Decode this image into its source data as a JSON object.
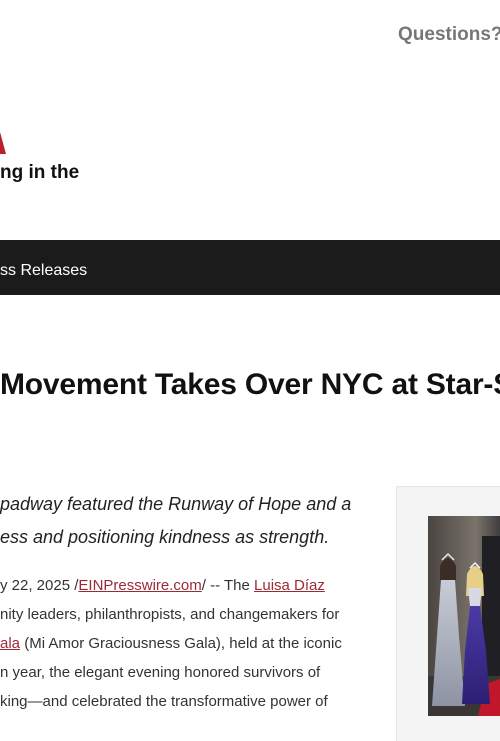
{
  "header": {
    "questions_label": "Questions?",
    "tagline": "ng in the"
  },
  "nav": {
    "item_label": "ss Releases"
  },
  "article": {
    "headline": "Movement Takes Over NYC at Star-S",
    "lede_lines": [
      "padway featured the Runway of Hope and a",
      "ess and positioning kindness as strength."
    ],
    "dateline_prefix": "y 22, 2025 /",
    "source_link": "EINPresswire.com",
    "dateline_middle": "/ -- The ",
    "person_link": "Luisa Díaz",
    "body_line_2": "nity leaders, philanthropists, and changemakers for",
    "gala_link": "ala",
    "body_line_3_rest": " (Mi Amor Graciousness Gala), held at the iconic",
    "body_line_4": "n year, the elegant evening honored survivors of",
    "body_line_5": "king—and celebrated the transformative power of"
  },
  "colors": {
    "navbar": "#1b1b1b",
    "link": "#9b2a35",
    "brand_red": "#b8202b",
    "sidebar_bg": "#f4f4f4"
  }
}
